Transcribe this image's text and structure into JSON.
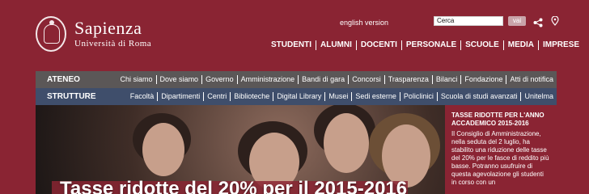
{
  "brand": {
    "name": "Sapienza",
    "subtitle": "Università di Roma"
  },
  "header": {
    "english_version": "english version",
    "search": {
      "value": "Cerca",
      "button": "vai"
    },
    "icons": [
      "share-icon",
      "map-pin-icon"
    ]
  },
  "topnav": {
    "items": [
      "STUDENTI",
      "ALUMNI",
      "DOCENTI",
      "PERSONALE",
      "SCUOLE",
      "MEDIA",
      "IMPRESE"
    ]
  },
  "ateneo": {
    "title": "ATENEO",
    "links": [
      "Chi siamo",
      "Dove siamo",
      "Governo",
      "Amministrazione",
      "Bandi di gara",
      "Concorsi",
      "Trasparenza",
      "Bilanci",
      "Fondazione",
      "Atti di notifica"
    ]
  },
  "strutture": {
    "title": "STRUTTURE",
    "links": [
      "Facoltà",
      "Dipartimenti",
      "Centri",
      "Biblioteche",
      "Digital Library",
      "Musei",
      "Sedi esterne",
      "Policlinici",
      "Scuola di studi avanzati",
      "Unitelma"
    ]
  },
  "hero": {
    "caption": "Tasse ridotte del 20% per il 2015-2016"
  },
  "news": {
    "title": "TASSE RIDOTTE PER L'ANNO ACCADEMICO 2015-2016",
    "body": "Il Consiglio di Amministrazione, nella seduta del 2 luglio, ha stabilito una riduzione delle tasse del 20% per le fasce di reddito più basse. Potranno usufruire di questa agevolazione gli studenti in corso con un"
  },
  "colors": {
    "brand": "#8a2433",
    "ateneo_bar": "#5b5757",
    "strutture_bar": "#3f4e6b"
  }
}
